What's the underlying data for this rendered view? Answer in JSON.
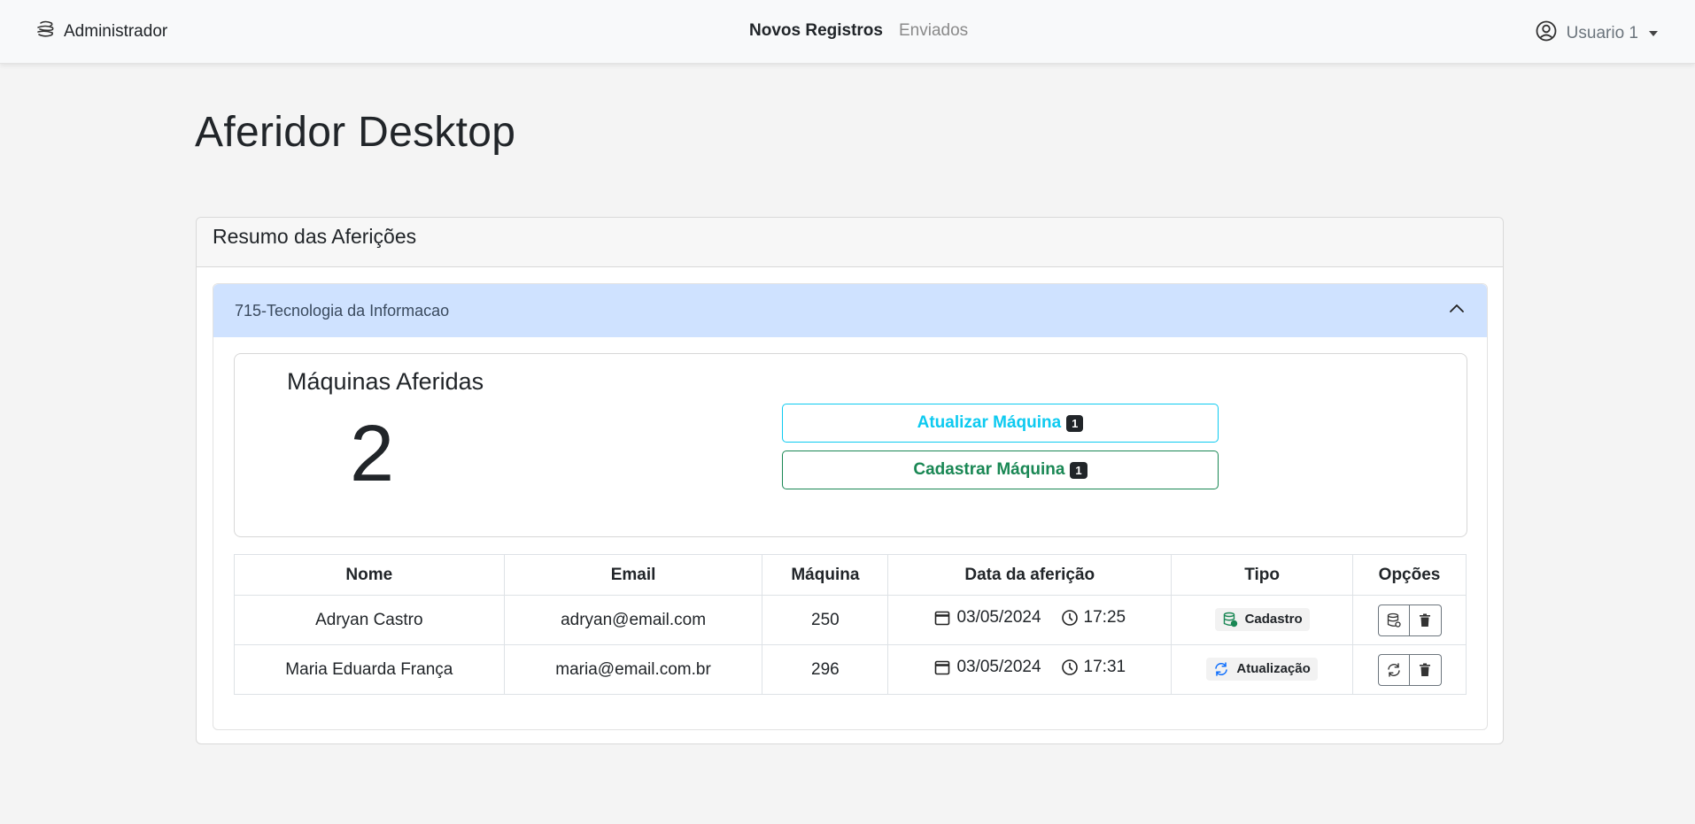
{
  "navbar": {
    "brand": "Administrador",
    "brand_icon": "stack-icon",
    "links": [
      {
        "label": "Novos Registros",
        "active": true
      },
      {
        "label": "Enviados",
        "active": false
      }
    ],
    "user": {
      "label": "Usuario 1",
      "icon": "user-circle-icon"
    }
  },
  "page": {
    "title": "Aferidor Desktop"
  },
  "card": {
    "header": "Resumo das Aferições",
    "accordion": {
      "title": "715-Tecnologia da Informacao",
      "expanded": true
    },
    "summary": {
      "title": "Máquinas Aferidas",
      "count": "2",
      "buttons": [
        {
          "label": "Atualizar Máquina",
          "badge": "1",
          "color": "#0dcaf0"
        },
        {
          "label": "Cadastrar Máquina",
          "badge": "1",
          "color": "#198754"
        }
      ]
    },
    "table": {
      "columns": [
        "Nome",
        "Email",
        "Máquina",
        "Data da aferição",
        "Tipo",
        "Opções"
      ],
      "rows": [
        {
          "nome": "Adryan Castro",
          "email": "adryan@email.com",
          "maquina": "250",
          "data": "03/05/2024",
          "hora": "17:25",
          "tipo": "Cadastro",
          "tipo_icon": "database-add-icon"
        },
        {
          "nome": "Maria Eduarda França",
          "email": "maria@email.com.br",
          "maquina": "296",
          "data": "03/05/2024",
          "hora": "17:31",
          "tipo": "Atualização",
          "tipo_icon": "refresh-icon"
        }
      ]
    }
  },
  "colors": {
    "accordion_bg": "#cfe2ff",
    "info": "#0dcaf0",
    "success": "#198754",
    "page_bg": "#f4f4f4"
  }
}
